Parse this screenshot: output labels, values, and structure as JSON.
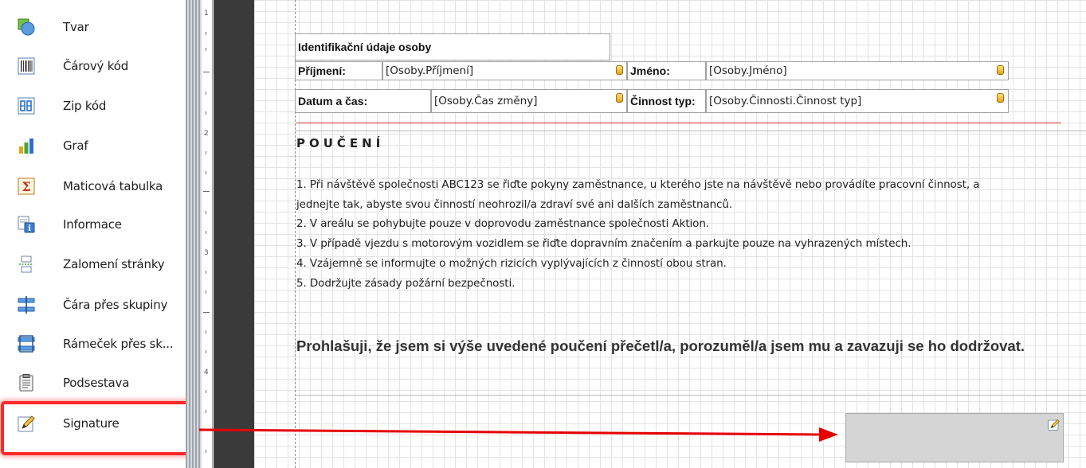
{
  "toolbox": {
    "items": [
      {
        "label": "Tvar",
        "icon": "shape-icon"
      },
      {
        "label": "Čárový kód",
        "icon": "barcode-icon"
      },
      {
        "label": "Zip kód",
        "icon": "zipcode-icon"
      },
      {
        "label": "Graf",
        "icon": "chart-icon"
      },
      {
        "label": "Maticová tabulka",
        "icon": "crosstab-icon"
      },
      {
        "label": "Informace",
        "icon": "info-icon"
      },
      {
        "label": "Zalomení stránky",
        "icon": "page-break-icon"
      },
      {
        "label": "Čára přes skupiny",
        "icon": "cross-band-line-icon"
      },
      {
        "label": "Rámeček přes sk...",
        "icon": "cross-band-box-icon"
      },
      {
        "label": "Podsestava",
        "icon": "subreport-icon"
      },
      {
        "label": "Signature",
        "icon": "signature-icon"
      }
    ],
    "highlighted_item": "Signature"
  },
  "ruler": {
    "labels": [
      "1",
      "2",
      "3",
      "4"
    ]
  },
  "report": {
    "header_title": "Identifikační údaje osoby",
    "row1": {
      "surname_label": "Příjmení:",
      "surname_field": "[Osoby.Příjmení]",
      "name_label": "Jméno:",
      "name_field": "[Osoby.Jméno]"
    },
    "row2": {
      "datetime_label": "Datum a čas:",
      "datetime_field": "[Osoby.Čas změny]",
      "activity_label": "Činnost typ:",
      "activity_field": "[Osoby.Činnosti.Činnost typ]"
    },
    "instructions_title": "POUČENÍ",
    "instructions": [
      "1. Při návštěvě společnosti ABC123 se řiďte pokyny zaměstnance, u kterého jste na návštěvě nebo provádíte pracovní činnost, a",
      "jednejte tak, abyste svou činností neohrozil/a zdraví své ani dalších zaměstnanců.",
      "2. V areálu se pohybujte pouze v doprovodu zaměstnance společnosti Aktion.",
      "3. V případě vjezdu s motorovým vozidlem se řiďte dopravním značením a parkujte pouze na vyhrazených místech.",
      "4. Vzájemně se informujte o možných rizicích vyplývajících z činností obou stran.",
      "5. Dodržujte zásady požární bezpečnosti."
    ],
    "declaration": "Prohlašuji, že jsem si výše uvedené poučení přečetl/a, porozuměl/a jsem mu a zavazuji se ho dodržovat."
  },
  "signature_control": {
    "icon": "signature-edit-icon"
  },
  "annotation": {
    "highlight_color": "#ff2a2a",
    "arrow_color": "#e60000"
  },
  "colors": {
    "rule_red": "#d42a2a",
    "surface_grid": "#e3e3e3",
    "signature_box": "#d5d5d5"
  }
}
